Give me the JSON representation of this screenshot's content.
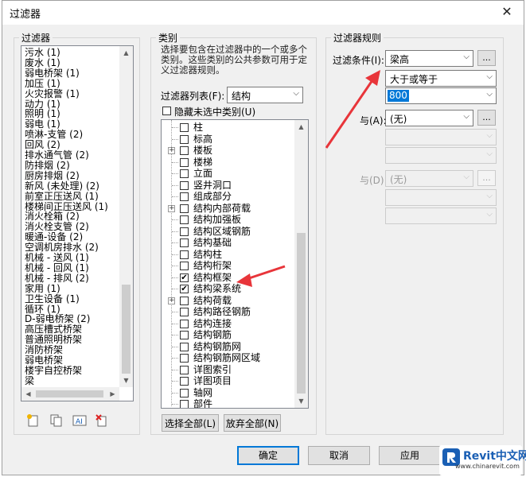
{
  "dialog": {
    "title": "过滤器",
    "close_icon": "close-icon"
  },
  "filters_panel": {
    "legend": "过滤器",
    "items": [
      "污水 (1)",
      "废水 (1)",
      "弱电桥架 (1)",
      "加压 (1)",
      "火灾报警 (1)",
      "动力 (1)",
      "照明 (1)",
      "弱电 (1)",
      "喷淋-支管 (2)",
      "回风 (2)",
      "排水通气管 (2)",
      "防排烟 (2)",
      "厨房排烟 (2)",
      "新风 (未处理) (2)",
      "前室正压送风 (1)",
      "楼梯间正压送风 (1)",
      "消火栓箱 (2)",
      "消火栓支管 (2)",
      "暖通-设备 (2)",
      "空调机房排水 (2)",
      "机械 - 送风 (1)",
      "机械 - 回风 (1)",
      "机械 - 排风 (2)",
      "家用 (1)",
      "卫生设备 (1)",
      "循环 (1)",
      "D-弱电桥架 (2)",
      "高压槽式桥架",
      "普通照明桥架",
      "消防桥架",
      "弱电桥架",
      "楼宇自控桥架",
      "梁"
    ],
    "toolbar_icons": [
      "new-filter-icon",
      "duplicate-filter-icon",
      "rename-filter-icon",
      "delete-filter-icon"
    ]
  },
  "categories_panel": {
    "legend": "类别",
    "description": "选择要包含在过滤器中的一个或多个类别。这些类别的公共参数可用于定义过滤器规则。",
    "filter_list_label": "过滤器列表(F):",
    "filter_list_value": "结构",
    "hide_unchecked_label": "隐藏未选中类别(U)",
    "tree": [
      {
        "label": "柱",
        "checked": false,
        "expandable": false,
        "level": 1
      },
      {
        "label": "标高",
        "checked": false,
        "expandable": false,
        "level": 1
      },
      {
        "label": "楼板",
        "checked": false,
        "expandable": true,
        "level": 1
      },
      {
        "label": "楼梯",
        "checked": false,
        "expandable": false,
        "level": 1
      },
      {
        "label": "立面",
        "checked": false,
        "expandable": false,
        "level": 1
      },
      {
        "label": "竖井洞口",
        "checked": false,
        "expandable": false,
        "level": 1
      },
      {
        "label": "组成部分",
        "checked": false,
        "expandable": false,
        "level": 1
      },
      {
        "label": "结构内部荷载",
        "checked": false,
        "expandable": true,
        "level": 1
      },
      {
        "label": "结构加强板",
        "checked": false,
        "expandable": false,
        "level": 1
      },
      {
        "label": "结构区域钢筋",
        "checked": false,
        "expandable": false,
        "level": 1
      },
      {
        "label": "结构基础",
        "checked": false,
        "expandable": false,
        "level": 1
      },
      {
        "label": "结构柱",
        "checked": false,
        "expandable": false,
        "level": 1
      },
      {
        "label": "结构桁架",
        "checked": false,
        "expandable": false,
        "level": 1
      },
      {
        "label": "结构框架",
        "checked": true,
        "expandable": false,
        "level": 1
      },
      {
        "label": "结构梁系统",
        "checked": true,
        "expandable": false,
        "level": 1
      },
      {
        "label": "结构荷载",
        "checked": false,
        "expandable": true,
        "level": 1
      },
      {
        "label": "结构路径钢筋",
        "checked": false,
        "expandable": false,
        "level": 1
      },
      {
        "label": "结构连接",
        "checked": false,
        "expandable": false,
        "level": 1
      },
      {
        "label": "结构钢筋",
        "checked": false,
        "expandable": false,
        "level": 1
      },
      {
        "label": "结构钢筋网",
        "checked": false,
        "expandable": false,
        "level": 1
      },
      {
        "label": "结构钢筋网区域",
        "checked": false,
        "expandable": false,
        "level": 1
      },
      {
        "label": "详图索引",
        "checked": false,
        "expandable": false,
        "level": 1
      },
      {
        "label": "详图项目",
        "checked": false,
        "expandable": false,
        "level": 1
      },
      {
        "label": "轴网",
        "checked": false,
        "expandable": false,
        "level": 1
      },
      {
        "label": "部件",
        "checked": false,
        "expandable": false,
        "level": 1
      }
    ],
    "select_all": "选择全部(L)",
    "deselect_all": "放弃全部(N)"
  },
  "rules_panel": {
    "legend": "过滤器规则",
    "filter_by_label": "过滤条件(I):",
    "parameter": "梁高",
    "operator": "大于或等于",
    "value": "800",
    "and1_label": "与(A):",
    "and1_value": "(无)",
    "and2_label": "与(D):",
    "and2_value": "(无)",
    "dots": "..."
  },
  "footer": {
    "ok": "确定",
    "cancel": "取消",
    "apply": "应用"
  },
  "watermark": {
    "brand": "Revit中文网",
    "url": "www.chinarevit.com"
  },
  "colors": {
    "annotation_arrow": "#e8353a",
    "focus_blue": "#0078d7",
    "brand_blue": "#1a5fb4"
  }
}
